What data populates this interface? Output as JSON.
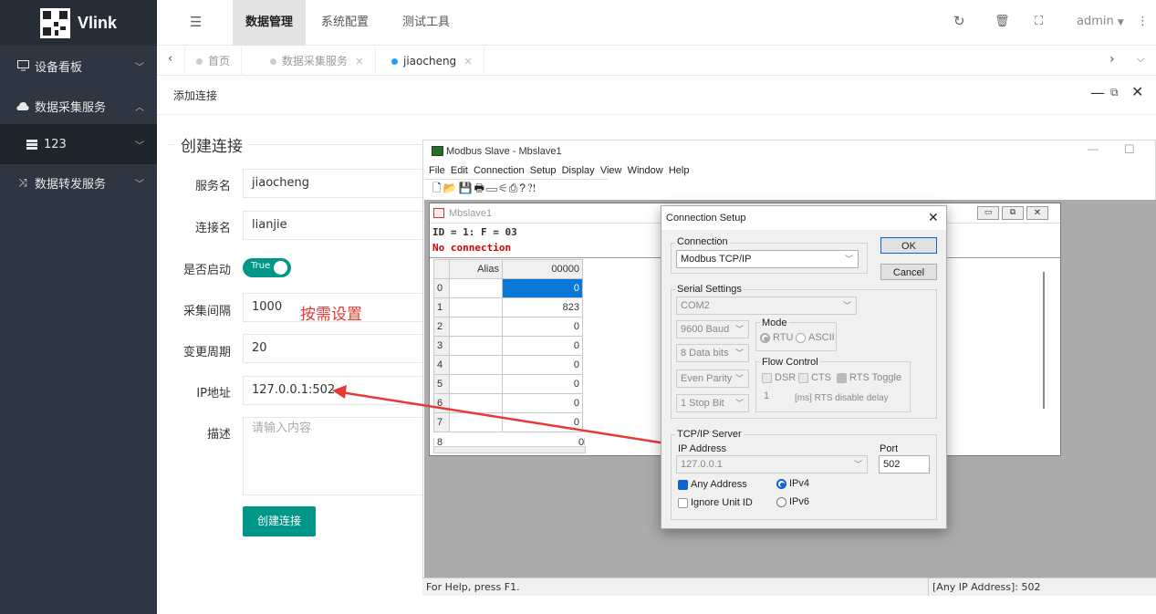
{
  "sidebar": {
    "logo_text": "Vlink",
    "items": [
      {
        "label": "设备看板",
        "icon": "monitor-icon"
      },
      {
        "label": "数据采集服务",
        "icon": "cloud-icon"
      },
      {
        "label": "123",
        "icon": "server-icon"
      },
      {
        "label": "数据转发服务",
        "icon": "shuffle-icon"
      }
    ]
  },
  "header": {
    "tabs": [
      "数据管理",
      "系统配置",
      "测试工具"
    ],
    "user": "admin"
  },
  "page_tabs": [
    "首页",
    "数据采集服务",
    "jiaocheng"
  ],
  "page_title": "添加连接",
  "form": {
    "section_title": "创建连接",
    "fields": [
      {
        "label": "服务名",
        "value": "jiaocheng"
      },
      {
        "label": "连接名",
        "value": "lianjie"
      },
      {
        "label": "是否启动",
        "value": "True"
      },
      {
        "label": "采集间隔",
        "value": "1000"
      },
      {
        "label": "变更周期",
        "value": "20"
      },
      {
        "label": "IP地址",
        "value": "127.0.0.1:502"
      },
      {
        "label": "描述",
        "placeholder": "请输入内容"
      }
    ],
    "note": "按需设置",
    "submit": "创建连接"
  },
  "modbus": {
    "title": "Modbus Slave - Mbslave1",
    "menu": [
      "File",
      "Edit",
      "Connection",
      "Setup",
      "Display",
      "View",
      "Window",
      "Help"
    ],
    "child_title": "Mbslave1",
    "id_line": "ID = 1: F = 03",
    "status": "No connection",
    "grid_headers": [
      "Alias",
      "00000"
    ],
    "rows": [
      {
        "idx": "0",
        "val": "0"
      },
      {
        "idx": "1",
        "val": "823"
      },
      {
        "idx": "2",
        "val": "0"
      },
      {
        "idx": "3",
        "val": "0"
      },
      {
        "idx": "4",
        "val": "0"
      },
      {
        "idx": "5",
        "val": "0"
      },
      {
        "idx": "6",
        "val": "0"
      },
      {
        "idx": "7",
        "val": "0"
      },
      {
        "idx": "8",
        "val": "0"
      }
    ],
    "statusbar_left": "For Help, press F1.",
    "statusbar_right": "[Any IP Address]: 502"
  },
  "dialog": {
    "title": "Connection Setup",
    "connection_group": "Connection",
    "connection_value": "Modbus TCP/IP",
    "ok": "OK",
    "cancel": "Cancel",
    "serial_group": "Serial Settings",
    "port": "COM2",
    "baud": "9600 Baud",
    "data_bits": "8 Data bits",
    "parity": "Even Parity",
    "stop_bits": "1 Stop Bit",
    "mode_group": "Mode",
    "mode_rtu": "RTU",
    "mode_ascii": "ASCII",
    "flow_group": "Flow Control",
    "dsr": "DSR",
    "cts": "CTS",
    "rts": "RTS Toggle",
    "rts_delay_value": "1",
    "rts_delay_label": "[ms] RTS disable delay",
    "tcp_group": "TCP/IP Server",
    "ip_label": "IP Address",
    "ip_value": "127.0.0.1",
    "port_label": "Port",
    "port_value": "502",
    "any_address": "Any Address",
    "ignore_unit": "Ignore Unit ID",
    "ipv4": "IPv4",
    "ipv6": "IPv6"
  },
  "colors": {
    "sidebar": "#2e3641",
    "accent": "#009688",
    "note": "#e53935",
    "arrow": "#e53935"
  }
}
